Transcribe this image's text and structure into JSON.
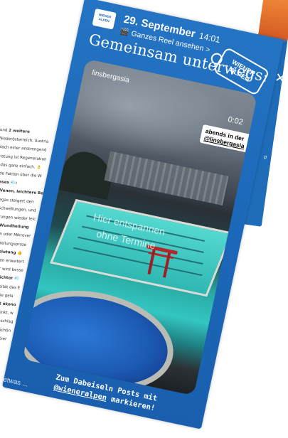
{
  "background_post": {
    "lines": [
      {
        "pre": "und ",
        "bold": "2 weitere",
        "post": ""
      },
      {
        "pre": "Niederösterreich, Austria",
        "bold": "",
        "post": ""
      },
      {
        "pre": "Nach einer anstrengend",
        "bold": "",
        "post": ""
      },
      {
        "pre": "eistung ist Regeneration",
        "bold": "",
        "post": ""
      },
      {
        "pre": "t das ganz einfach. 👌",
        "bold": "",
        "post": ""
      },
      {
        "pre": "nde Fakten über die W",
        "bold": "",
        "post": ""
      },
      {
        "pre": "",
        "bold": "gases 💨:",
        "post": ""
      },
      {
        "pre": "",
        "bold": "e Venen, leichtere Be",
        "post": ""
      },
      {
        "pre": "uregas steigert den",
        "bold": "",
        "post": ""
      },
      {
        "pre": "n Schwellungen, und",
        "bold": "",
        "post": ""
      },
      {
        "pre": "derungen wieder leic",
        "bold": "",
        "post": ""
      },
      {
        "pre": "",
        "bold": "re Wundheilung",
        "post": ""
      },
      {
        "pre": "asen oder Mikrover",
        "bold": "",
        "post": ""
      },
      {
        "pre": "en Heilungsproze",
        "bold": "",
        "post": ""
      },
      {
        "pre": "",
        "bold": "rchblutung 👍",
        "post": ""
      },
      {
        "pre": "verden erweitert",
        "bold": "",
        "post": ""
      },
      {
        "pre": "örper wird besse",
        "bold": "",
        "post": ""
      },
      {
        "pre": "",
        "bold": "ßt leichter 💨",
        "post": ""
      },
      {
        "pre": "Viskosität des E",
        "bold": "",
        "post": ""
      },
      {
        "pre": "Energie gela",
        "bold": "",
        "post": ""
      },
      {
        "pre": "",
        "bold": "beitet ökono",
        "post": ""
      },
      {
        "pre": "uenz sinkt, w",
        "bold": "",
        "post": ""
      },
      {
        "pre": "s Herz schlag",
        "bold": "",
        "post": ""
      },
      {
        "pre": "e Bad Schön",
        "bold": "",
        "post": ""
      },
      {
        "pre": "Fülöp, Krer",
        "bold": "",
        "post": ""
      }
    ]
  },
  "next_story": {
    "peek_text": "p"
  },
  "story": {
    "logo_text": "WIENER ALPEN",
    "date": "29. September",
    "time": "14:01",
    "reel_link": "Ganzes Reel ansehen >",
    "title": "Gemeinsam unterwegs:",
    "tag_sign": "WIENER ALPEN",
    "close_glyph": "✕",
    "video": {
      "account": "linsbergasia",
      "timestamp": "0:02",
      "mention_prefix": "abends in der",
      "mention_handle": "@linsbergasia",
      "overlay_line1": "Hier entspannen",
      "overlay_line2": "ohne Termine"
    },
    "cta_line1": "Zum Dabeiseln Posts mit",
    "cta_handle": "@wieneralpen",
    "cta_line2": "markieren!",
    "reply_placeholder": "Sag etwas ..."
  },
  "colors": {
    "story_blue": "#1b67b8",
    "torii_red": "#b5262a",
    "pool_teal": "#33c6c1"
  }
}
